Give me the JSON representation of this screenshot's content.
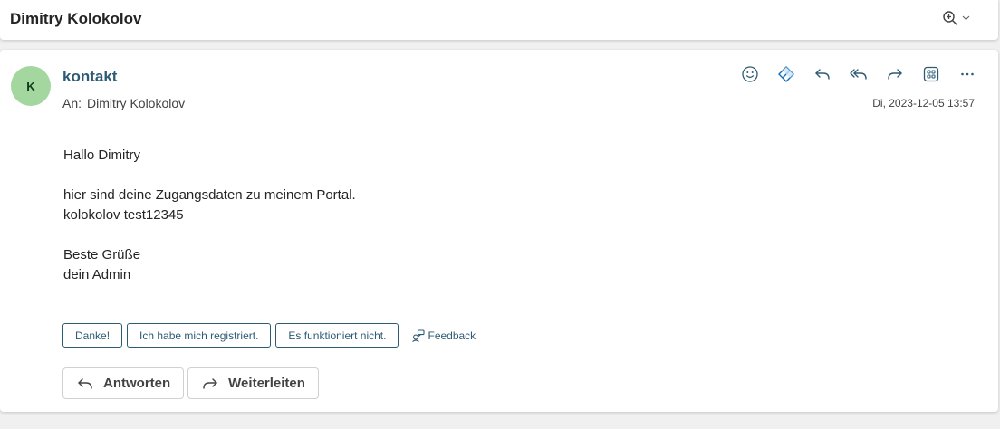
{
  "header": {
    "subject": "Dimitry Kolokolov"
  },
  "message": {
    "avatar_initial": "K",
    "avatar_color": "#a4d7a0",
    "sender_name": "kontakt",
    "sender_color": "#2d5b74",
    "to_label": "An:",
    "to_name": "Dimitry Kolokolov",
    "date": "Di, 2023-12-05 13:57",
    "actions": [
      "smile-icon",
      "tag-icon",
      "reply-icon",
      "reply-all-icon",
      "forward-icon",
      "apps-icon",
      "more-icon"
    ],
    "body_lines": [
      "Hallo Dimitry",
      "",
      "hier sind deine Zugangsdaten zu meinem Portal.",
      "kolokolov test12345",
      "",
      "Beste Grüße",
      "dein Admin"
    ]
  },
  "suggested_replies": [
    "Danke!",
    "Ich habe mich registriert.",
    "Es funktioniert nicht."
  ],
  "feedback_label": "Feedback",
  "buttons": {
    "reply": "Antworten",
    "forward": "Weiterleiten"
  },
  "colors": {
    "accent": "#2d5b74",
    "icon_blue": "#0f6cbd",
    "background": "#f0f0f0"
  }
}
